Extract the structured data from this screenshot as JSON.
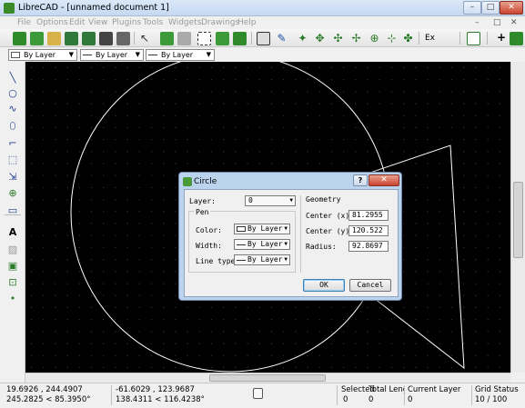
{
  "window": {
    "title": "LibreCAD - [unnamed document 1]",
    "min": "–",
    "max": "□",
    "close": "✕"
  },
  "menu": [
    "File",
    "Options",
    "Edit",
    "View",
    "Plugins",
    "Tools",
    "Widgets",
    "Drawings",
    "Help"
  ],
  "mdi": {
    "min": "–",
    "restore": "□",
    "close": "✕"
  },
  "toolbar": {
    "ex_label": "Ex"
  },
  "layerbar": {
    "color": "By Layer",
    "width": "By Layer",
    "linetype": "By Layer"
  },
  "status": {
    "abs_coord": "19.6926 , 244.4907",
    "abs_polar": "245.2825 < 85.3950°",
    "rel_coord": "-61.6029 , 123.9687",
    "rel_polar": "138.4311 < 116.4238°",
    "selected_label": "Selected",
    "selected_value": "0",
    "total_length_label": "Total Length",
    "total_length_value": "0",
    "current_layer_label": "Current Layer",
    "current_layer_value": "0",
    "grid_label": "Grid Status",
    "grid_value": "10 / 100"
  },
  "dialog": {
    "title": "Circle",
    "help": "?",
    "close": "✕",
    "layer_label": "Layer:",
    "layer_value": "0",
    "pen_label": "Pen",
    "color_label": "Color:",
    "color_value": "By Layer",
    "width_label": "Width:",
    "width_value": "By Layer",
    "linetype_label": "Line type:",
    "linetype_value": "By Layer",
    "geometry_label": "Geometry",
    "cx_label": "Center (x):",
    "cx_value": "81.2955",
    "cy_label": "Center (y):",
    "cy_value": "120.522",
    "radius_label": "Radius:",
    "radius_value": "92.8697",
    "ok": "OK",
    "cancel": "Cancel"
  },
  "colors": {
    "canvas": "#000000",
    "entity": "#ffffff",
    "accent": "#3a8a2a"
  }
}
